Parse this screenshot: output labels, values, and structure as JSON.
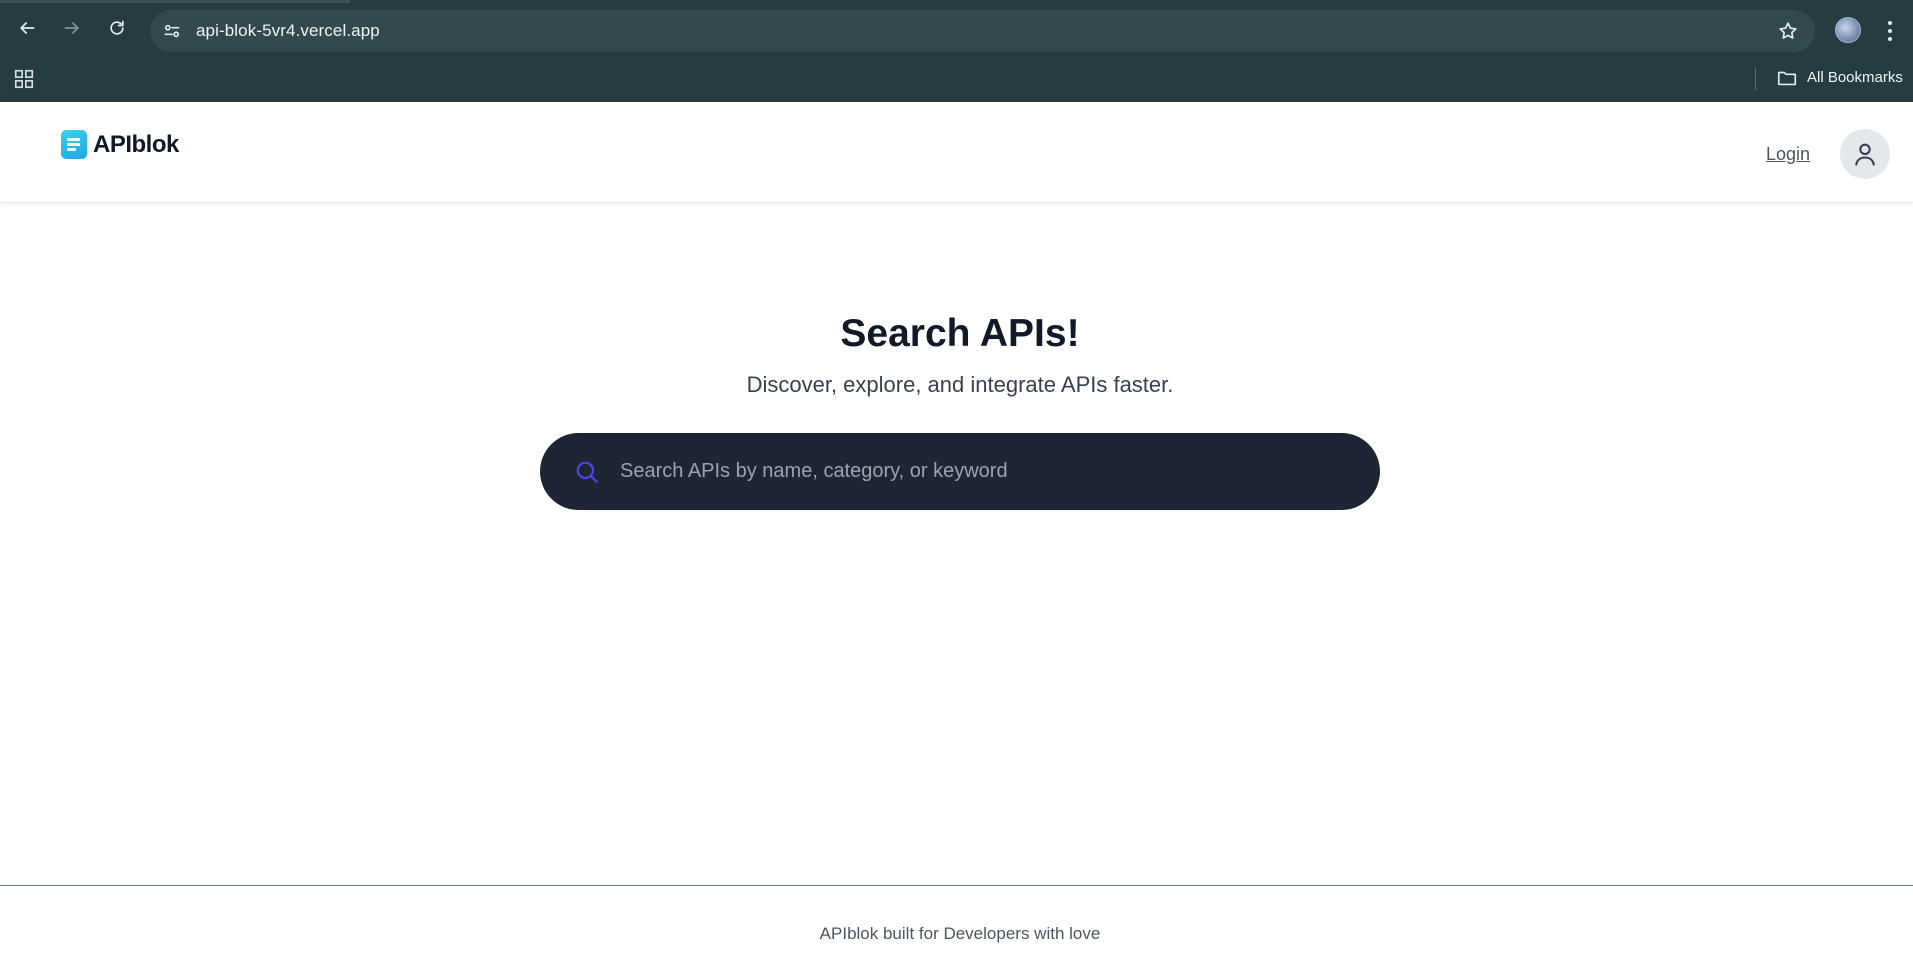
{
  "browser": {
    "url": "api-blok-5vr4.vercel.app",
    "bookmarks_label": "All Bookmarks",
    "icons": [
      "back-arrow-icon",
      "forward-arrow-icon",
      "reload-icon",
      "site-settings-icon",
      "bookmark-star-icon",
      "profile-avatar",
      "more-menu-icon",
      "apps-grid-icon",
      "folder-icon"
    ]
  },
  "header": {
    "logo_text": "APIblok",
    "login_label": "Login",
    "avatar_icon": "user-icon"
  },
  "hero": {
    "title": "Search APIs!",
    "subtitle": "Discover, explore, and integrate APIs faster."
  },
  "search": {
    "placeholder": "Search APIs by name, category, or keyword",
    "value": "",
    "icon": "search-icon"
  },
  "footer": {
    "text": "APIblok built for Developers with love"
  },
  "colors": {
    "chrome_bg": "#253d40",
    "search_bg": "#1f2534",
    "search_icon": "#4f46e5",
    "logo_gradient_start": "#38d3e6",
    "logo_gradient_end": "#1ea7e8",
    "title_text": "#111827"
  }
}
